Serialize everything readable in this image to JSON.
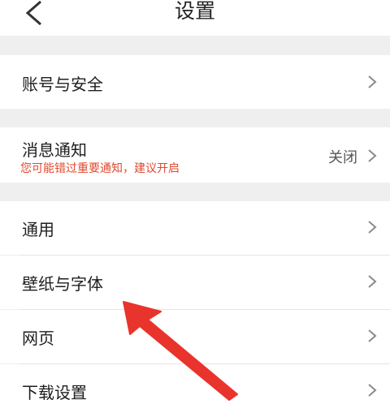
{
  "header": {
    "title": "设置"
  },
  "sections": {
    "account": {
      "label": "账号与安全"
    },
    "notify": {
      "label": "消息通知",
      "sublabel": "您可能错过重要通知，建议开启",
      "value": "关闭"
    },
    "general": {
      "label": "通用"
    },
    "wallpaper": {
      "label": "壁纸与字体"
    },
    "webpage": {
      "label": "网页"
    },
    "download": {
      "label": "下载设置"
    }
  },
  "colors": {
    "warning_text": "#e0492f",
    "annotation_arrow": "#e8342c"
  },
  "icons": {
    "back": "chevron-left-icon",
    "row_arrow": "chevron-right-icon"
  }
}
